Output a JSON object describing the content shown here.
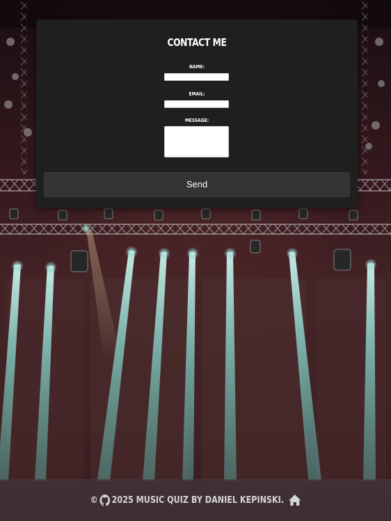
{
  "contact": {
    "title": "Contact me",
    "name_label": "Name:",
    "email_label": "Email:",
    "message_label": "Message:",
    "name_value": "",
    "email_value": "",
    "message_value": "",
    "send_label": "Send"
  },
  "footer": {
    "copyright_symbol": "©",
    "text": "2025 Music Quiz by Daniel Kepinski.",
    "icons": [
      "github-icon",
      "home-icon"
    ]
  },
  "background": {
    "description_icon": "stage-lights-background",
    "beam_color": "#9fe6df",
    "truss_color": "#d9d9d9"
  }
}
